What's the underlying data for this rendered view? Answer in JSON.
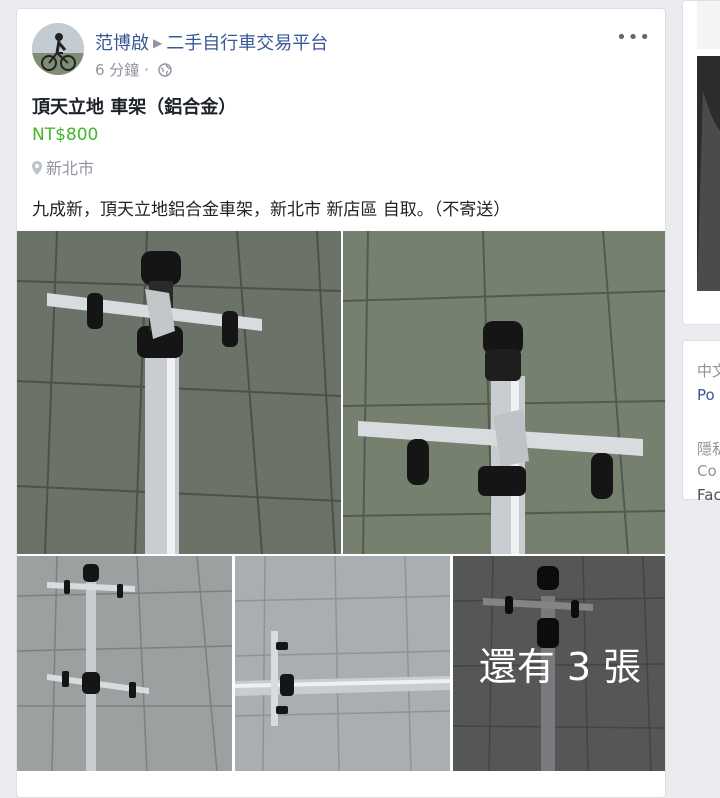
{
  "post": {
    "author": "范博啟",
    "group": "二手自行車交易平台",
    "time": "6 分鐘",
    "dot": "·",
    "more_icon": "more-options-icon",
    "title": "頂天立地 車架（鋁合金）",
    "price": "NT$800",
    "location": "新北市",
    "description": "九成新，頂天立地鋁合金車架，新北市 新店區 自取。（不寄送）",
    "more_photos": "還有 3 張"
  },
  "sidebar": {
    "line1": "中文",
    "line2": "Po",
    "line3": "隱私",
    "line4": "Co",
    "line5": "Fac"
  },
  "colors": {
    "link": "#385898",
    "price": "#42b72a",
    "muted": "#90949c",
    "background": "#e9ebee"
  }
}
